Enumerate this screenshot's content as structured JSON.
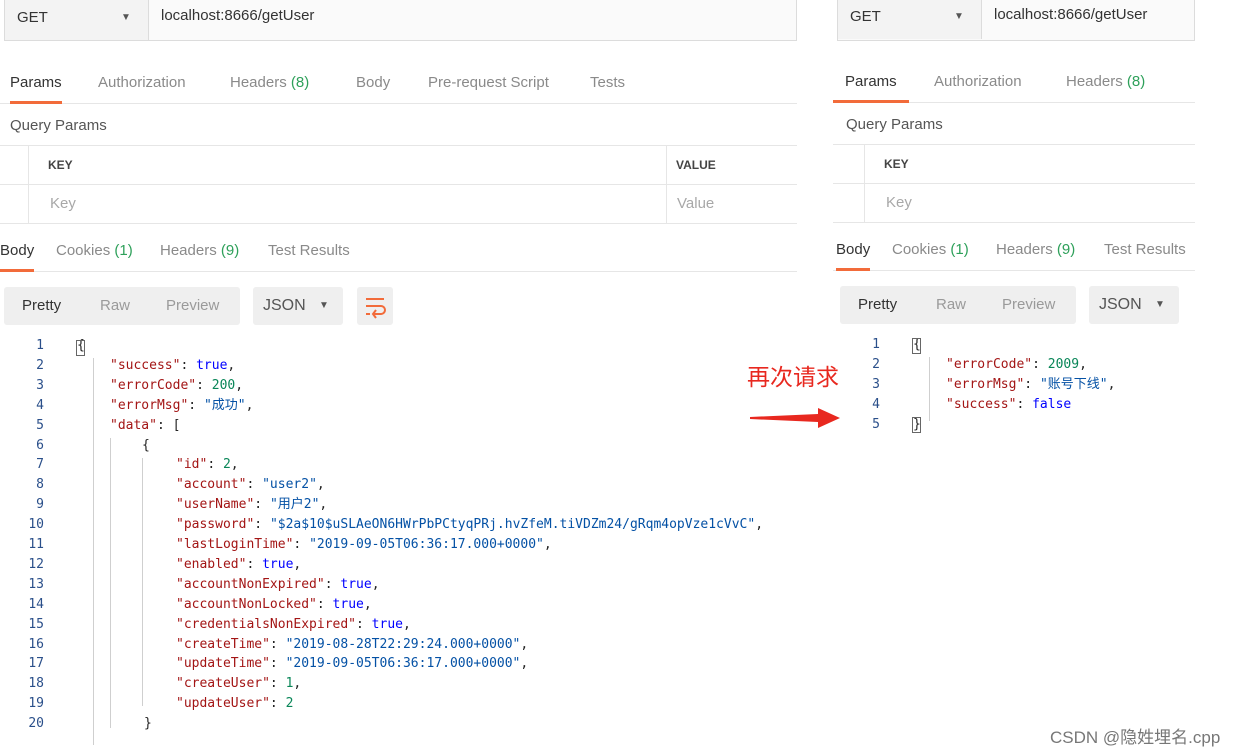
{
  "left": {
    "method": "GET",
    "url": "localhost:8666/getUser",
    "request_tabs": [
      "Params",
      "Authorization",
      "Headers",
      "Body",
      "Pre-request Script",
      "Tests"
    ],
    "request_headers_count": "(8)",
    "query_params_title": "Query Params",
    "col_key": "KEY",
    "col_value": "VALUE",
    "key_placeholder": "Key",
    "value_placeholder": "Value",
    "response_tabs": [
      "Body",
      "Cookies",
      "Headers",
      "Test Results"
    ],
    "cookies_count": "(1)",
    "response_headers_count": "(9)",
    "view_buttons": [
      "Pretty",
      "Raw",
      "Preview"
    ],
    "format": "JSON",
    "code_lines": [
      [
        [
          "p",
          "{"
        ]
      ],
      [
        [
          "k",
          "\"success\""
        ],
        [
          "p",
          ": "
        ],
        [
          "b",
          "true"
        ],
        [
          "p",
          ","
        ]
      ],
      [
        [
          "k",
          "\"errorCode\""
        ],
        [
          "p",
          ": "
        ],
        [
          "n",
          "200"
        ],
        [
          "p",
          ","
        ]
      ],
      [
        [
          "k",
          "\"errorMsg\""
        ],
        [
          "p",
          ": "
        ],
        [
          "s",
          "\"成功\""
        ],
        [
          "p",
          ","
        ]
      ],
      [
        [
          "k",
          "\"data\""
        ],
        [
          "p",
          ": ["
        ]
      ],
      [
        [
          "p",
          "{"
        ]
      ],
      [
        [
          "k",
          "\"id\""
        ],
        [
          "p",
          ": "
        ],
        [
          "n",
          "2"
        ],
        [
          "p",
          ","
        ]
      ],
      [
        [
          "k",
          "\"account\""
        ],
        [
          "p",
          ": "
        ],
        [
          "s",
          "\"user2\""
        ],
        [
          "p",
          ","
        ]
      ],
      [
        [
          "k",
          "\"userName\""
        ],
        [
          "p",
          ": "
        ],
        [
          "s",
          "\"用户2\""
        ],
        [
          "p",
          ","
        ]
      ],
      [
        [
          "k",
          "\"password\""
        ],
        [
          "p",
          ": "
        ],
        [
          "s",
          "\"$2a$10$uSLAeON6HWrPbPCtyqPRj.hvZfeM.tiVDZm24/gRqm4opVze1cVvC\""
        ],
        [
          "p",
          ","
        ]
      ],
      [
        [
          "k",
          "\"lastLoginTime\""
        ],
        [
          "p",
          ": "
        ],
        [
          "s",
          "\"2019-09-05T06:36:17.000+0000\""
        ],
        [
          "p",
          ","
        ]
      ],
      [
        [
          "k",
          "\"enabled\""
        ],
        [
          "p",
          ": "
        ],
        [
          "b",
          "true"
        ],
        [
          "p",
          ","
        ]
      ],
      [
        [
          "k",
          "\"accountNonExpired\""
        ],
        [
          "p",
          ": "
        ],
        [
          "b",
          "true"
        ],
        [
          "p",
          ","
        ]
      ],
      [
        [
          "k",
          "\"accountNonLocked\""
        ],
        [
          "p",
          ": "
        ],
        [
          "b",
          "true"
        ],
        [
          "p",
          ","
        ]
      ],
      [
        [
          "k",
          "\"credentialsNonExpired\""
        ],
        [
          "p",
          ": "
        ],
        [
          "b",
          "true"
        ],
        [
          "p",
          ","
        ]
      ],
      [
        [
          "k",
          "\"createTime\""
        ],
        [
          "p",
          ": "
        ],
        [
          "s",
          "\"2019-08-28T22:29:24.000+0000\""
        ],
        [
          "p",
          ","
        ]
      ],
      [
        [
          "k",
          "\"updateTime\""
        ],
        [
          "p",
          ": "
        ],
        [
          "s",
          "\"2019-09-05T06:36:17.000+0000\""
        ],
        [
          "p",
          ","
        ]
      ],
      [
        [
          "k",
          "\"createUser\""
        ],
        [
          "p",
          ": "
        ],
        [
          "n",
          "1"
        ],
        [
          "p",
          ","
        ]
      ],
      [
        [
          "k",
          "\"updateUser\""
        ],
        [
          "p",
          ": "
        ],
        [
          "n",
          "2"
        ]
      ],
      [
        [
          "p",
          "}"
        ]
      ]
    ]
  },
  "right": {
    "method": "GET",
    "url": "localhost:8666/getUser",
    "request_tabs": [
      "Params",
      "Authorization",
      "Headers"
    ],
    "request_headers_count": "(8)",
    "query_params_title": "Query Params",
    "col_key": "KEY",
    "key_placeholder": "Key",
    "response_tabs": [
      "Body",
      "Cookies",
      "Headers",
      "Test Results"
    ],
    "cookies_count": "(1)",
    "response_headers_count": "(9)",
    "view_buttons": [
      "Pretty",
      "Raw",
      "Preview"
    ],
    "format": "JSON",
    "code_lines": [
      [
        [
          "p",
          "{"
        ]
      ],
      [
        [
          "k",
          "\"errorCode\""
        ],
        [
          "p",
          ": "
        ],
        [
          "n",
          "2009"
        ],
        [
          "p",
          ","
        ]
      ],
      [
        [
          "k",
          "\"errorMsg\""
        ],
        [
          "p",
          ": "
        ],
        [
          "s",
          "\"账号下线\""
        ],
        [
          "p",
          ","
        ]
      ],
      [
        [
          "k",
          "\"success\""
        ],
        [
          "p",
          ": "
        ],
        [
          "b",
          "false"
        ]
      ],
      [
        [
          "p",
          "}"
        ]
      ]
    ]
  },
  "annotation": "再次请求",
  "watermark": "CSDN @隐姓埋名.cpp",
  "colors": {
    "accent": "#f26b3a",
    "count_green": "#2ea05a",
    "annotation_red": "#e8281f",
    "json_key": "#a31515",
    "json_string": "#0451a5",
    "json_bool": "#0000ff",
    "json_number": "#098658"
  }
}
